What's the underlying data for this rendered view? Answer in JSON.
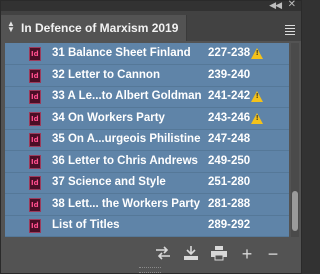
{
  "panel": {
    "title": "In Defence of Marxism 2019"
  },
  "documents": [
    {
      "name": "31 Balance Sheet Finland",
      "pages": "227-238",
      "warning": true
    },
    {
      "name": "32 Letter to Cannon",
      "pages": "239-240",
      "warning": false
    },
    {
      "name": "33 A Le...to Albert Goldman",
      "pages": "241-242",
      "warning": true
    },
    {
      "name": "34 On Workers Party",
      "pages": "243-246",
      "warning": true
    },
    {
      "name": "35 On A...urgeois Philistine",
      "pages": "247-248",
      "warning": false
    },
    {
      "name": "36 Letter to Chris Andrews",
      "pages": "249-250",
      "warning": false
    },
    {
      "name": "37 Science and Style",
      "pages": "251-280",
      "warning": false
    },
    {
      "name": "38 Lett... the Workers Party",
      "pages": "281-288",
      "warning": false
    },
    {
      "name": "List of Titles",
      "pages": "289-292",
      "warning": false
    }
  ],
  "document_icon_label": "Id",
  "warning_symbol": "!",
  "icons": {
    "collapse": "double-chevron-left-icon",
    "close": "close-icon",
    "menu": "panel-menu-icon",
    "sync": "synchronize-icon",
    "save": "save-book-icon",
    "print": "print-icon",
    "add": "add-document-icon",
    "remove": "remove-document-icon"
  },
  "colors": {
    "selection": "#5f84a8",
    "panel_bg": "#535353",
    "warning": "#f3c21b",
    "indesign_icon": "#ff4f8f"
  }
}
